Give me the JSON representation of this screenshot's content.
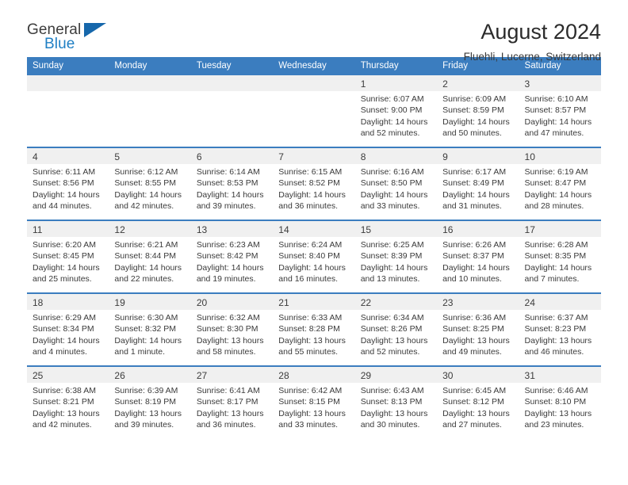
{
  "brand": {
    "name_top": "General",
    "name_bottom": "Blue",
    "flag_icon": "triangle-flag-icon",
    "accent_color": "#1667ab",
    "blue_text_color": "#1f7fc4"
  },
  "header": {
    "title": "August 2024",
    "subtitle": "Fluehli, Lucerne, Switzerland"
  },
  "calendar": {
    "header_bg": "#3b7dbf",
    "daynum_bg": "#f0f0f0",
    "weekdays": [
      "Sunday",
      "Monday",
      "Tuesday",
      "Wednesday",
      "Thursday",
      "Friday",
      "Saturday"
    ],
    "weeks": [
      [
        {
          "day": "",
          "empty": true,
          "sunrise": "",
          "sunset": "",
          "daylight": ""
        },
        {
          "day": "",
          "empty": true,
          "sunrise": "",
          "sunset": "",
          "daylight": ""
        },
        {
          "day": "",
          "empty": true,
          "sunrise": "",
          "sunset": "",
          "daylight": ""
        },
        {
          "day": "",
          "empty": true,
          "sunrise": "",
          "sunset": "",
          "daylight": ""
        },
        {
          "day": "1",
          "sunrise": "Sunrise: 6:07 AM",
          "sunset": "Sunset: 9:00 PM",
          "daylight": "Daylight: 14 hours and 52 minutes."
        },
        {
          "day": "2",
          "sunrise": "Sunrise: 6:09 AM",
          "sunset": "Sunset: 8:59 PM",
          "daylight": "Daylight: 14 hours and 50 minutes."
        },
        {
          "day": "3",
          "sunrise": "Sunrise: 6:10 AM",
          "sunset": "Sunset: 8:57 PM",
          "daylight": "Daylight: 14 hours and 47 minutes."
        }
      ],
      [
        {
          "day": "4",
          "sunrise": "Sunrise: 6:11 AM",
          "sunset": "Sunset: 8:56 PM",
          "daylight": "Daylight: 14 hours and 44 minutes."
        },
        {
          "day": "5",
          "sunrise": "Sunrise: 6:12 AM",
          "sunset": "Sunset: 8:55 PM",
          "daylight": "Daylight: 14 hours and 42 minutes."
        },
        {
          "day": "6",
          "sunrise": "Sunrise: 6:14 AM",
          "sunset": "Sunset: 8:53 PM",
          "daylight": "Daylight: 14 hours and 39 minutes."
        },
        {
          "day": "7",
          "sunrise": "Sunrise: 6:15 AM",
          "sunset": "Sunset: 8:52 PM",
          "daylight": "Daylight: 14 hours and 36 minutes."
        },
        {
          "day": "8",
          "sunrise": "Sunrise: 6:16 AM",
          "sunset": "Sunset: 8:50 PM",
          "daylight": "Daylight: 14 hours and 33 minutes."
        },
        {
          "day": "9",
          "sunrise": "Sunrise: 6:17 AM",
          "sunset": "Sunset: 8:49 PM",
          "daylight": "Daylight: 14 hours and 31 minutes."
        },
        {
          "day": "10",
          "sunrise": "Sunrise: 6:19 AM",
          "sunset": "Sunset: 8:47 PM",
          "daylight": "Daylight: 14 hours and 28 minutes."
        }
      ],
      [
        {
          "day": "11",
          "sunrise": "Sunrise: 6:20 AM",
          "sunset": "Sunset: 8:45 PM",
          "daylight": "Daylight: 14 hours and 25 minutes."
        },
        {
          "day": "12",
          "sunrise": "Sunrise: 6:21 AM",
          "sunset": "Sunset: 8:44 PM",
          "daylight": "Daylight: 14 hours and 22 minutes."
        },
        {
          "day": "13",
          "sunrise": "Sunrise: 6:23 AM",
          "sunset": "Sunset: 8:42 PM",
          "daylight": "Daylight: 14 hours and 19 minutes."
        },
        {
          "day": "14",
          "sunrise": "Sunrise: 6:24 AM",
          "sunset": "Sunset: 8:40 PM",
          "daylight": "Daylight: 14 hours and 16 minutes."
        },
        {
          "day": "15",
          "sunrise": "Sunrise: 6:25 AM",
          "sunset": "Sunset: 8:39 PM",
          "daylight": "Daylight: 14 hours and 13 minutes."
        },
        {
          "day": "16",
          "sunrise": "Sunrise: 6:26 AM",
          "sunset": "Sunset: 8:37 PM",
          "daylight": "Daylight: 14 hours and 10 minutes."
        },
        {
          "day": "17",
          "sunrise": "Sunrise: 6:28 AM",
          "sunset": "Sunset: 8:35 PM",
          "daylight": "Daylight: 14 hours and 7 minutes."
        }
      ],
      [
        {
          "day": "18",
          "sunrise": "Sunrise: 6:29 AM",
          "sunset": "Sunset: 8:34 PM",
          "daylight": "Daylight: 14 hours and 4 minutes."
        },
        {
          "day": "19",
          "sunrise": "Sunrise: 6:30 AM",
          "sunset": "Sunset: 8:32 PM",
          "daylight": "Daylight: 14 hours and 1 minute."
        },
        {
          "day": "20",
          "sunrise": "Sunrise: 6:32 AM",
          "sunset": "Sunset: 8:30 PM",
          "daylight": "Daylight: 13 hours and 58 minutes."
        },
        {
          "day": "21",
          "sunrise": "Sunrise: 6:33 AM",
          "sunset": "Sunset: 8:28 PM",
          "daylight": "Daylight: 13 hours and 55 minutes."
        },
        {
          "day": "22",
          "sunrise": "Sunrise: 6:34 AM",
          "sunset": "Sunset: 8:26 PM",
          "daylight": "Daylight: 13 hours and 52 minutes."
        },
        {
          "day": "23",
          "sunrise": "Sunrise: 6:36 AM",
          "sunset": "Sunset: 8:25 PM",
          "daylight": "Daylight: 13 hours and 49 minutes."
        },
        {
          "day": "24",
          "sunrise": "Sunrise: 6:37 AM",
          "sunset": "Sunset: 8:23 PM",
          "daylight": "Daylight: 13 hours and 46 minutes."
        }
      ],
      [
        {
          "day": "25",
          "sunrise": "Sunrise: 6:38 AM",
          "sunset": "Sunset: 8:21 PM",
          "daylight": "Daylight: 13 hours and 42 minutes."
        },
        {
          "day": "26",
          "sunrise": "Sunrise: 6:39 AM",
          "sunset": "Sunset: 8:19 PM",
          "daylight": "Daylight: 13 hours and 39 minutes."
        },
        {
          "day": "27",
          "sunrise": "Sunrise: 6:41 AM",
          "sunset": "Sunset: 8:17 PM",
          "daylight": "Daylight: 13 hours and 36 minutes."
        },
        {
          "day": "28",
          "sunrise": "Sunrise: 6:42 AM",
          "sunset": "Sunset: 8:15 PM",
          "daylight": "Daylight: 13 hours and 33 minutes."
        },
        {
          "day": "29",
          "sunrise": "Sunrise: 6:43 AM",
          "sunset": "Sunset: 8:13 PM",
          "daylight": "Daylight: 13 hours and 30 minutes."
        },
        {
          "day": "30",
          "sunrise": "Sunrise: 6:45 AM",
          "sunset": "Sunset: 8:12 PM",
          "daylight": "Daylight: 13 hours and 27 minutes."
        },
        {
          "day": "31",
          "sunrise": "Sunrise: 6:46 AM",
          "sunset": "Sunset: 8:10 PM",
          "daylight": "Daylight: 13 hours and 23 minutes."
        }
      ]
    ]
  }
}
